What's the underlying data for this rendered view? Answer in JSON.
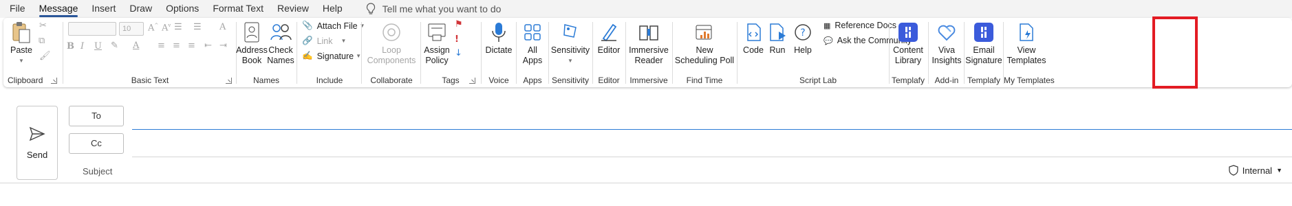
{
  "menu": {
    "tabs": [
      "File",
      "Message",
      "Insert",
      "Draw",
      "Options",
      "Format Text",
      "Review",
      "Help"
    ],
    "active_tab": "Message",
    "tell_me": "Tell me what you want to do"
  },
  "ribbon": {
    "clipboard": {
      "paste": "Paste",
      "label": "Clipboard"
    },
    "basic_text": {
      "font_size": "10",
      "label": "Basic Text"
    },
    "names": {
      "address_book_1": "Address",
      "address_book_2": "Book",
      "check_names_1": "Check",
      "check_names_2": "Names",
      "label": "Names"
    },
    "include": {
      "attach_file": "Attach File",
      "link": "Link",
      "signature": "Signature",
      "label": "Include"
    },
    "collaborate": {
      "loop_1": "Loop",
      "loop_2": "Components",
      "label": "Collaborate"
    },
    "tags": {
      "assign_1": "Assign",
      "assign_2": "Policy",
      "label": "Tags"
    },
    "voice": {
      "dictate": "Dictate",
      "label": "Voice"
    },
    "apps": {
      "all_1": "All",
      "all_2": "Apps",
      "label": "Apps"
    },
    "sensitivity": {
      "button": "Sensitivity",
      "label": "Sensitivity"
    },
    "editor": {
      "button": "Editor",
      "label": "Editor"
    },
    "immersive": {
      "btn_1": "Immersive",
      "btn_2": "Reader",
      "label": "Immersive"
    },
    "find_time": {
      "btn_1": "New",
      "btn_2": "Scheduling Poll",
      "label": "Find Time"
    },
    "script_lab": {
      "code": "Code",
      "run": "Run",
      "help": "Help",
      "reference_docs": "Reference Docs",
      "ask_community": "Ask the Community",
      "label": "Script Lab"
    },
    "templafy": {
      "btn_1": "Content",
      "btn_2": "Library",
      "label": "Templafy"
    },
    "addin": {
      "btn_1": "Viva",
      "btn_2": "Insights",
      "label": "Add-in"
    },
    "templafy2": {
      "btn_1": "Email",
      "btn_2": "Signature",
      "label": "Templafy"
    },
    "my_templates": {
      "btn_1": "View",
      "btn_2": "Templates",
      "label": "My Templates"
    }
  },
  "compose": {
    "send": "Send",
    "to": "To",
    "cc": "Cc",
    "subject": "Subject",
    "sensitivity": "Internal"
  },
  "colors": {
    "accent": "#2b579a",
    "templafy": "#3b5bdb",
    "highlight": "#e31b23",
    "active_line": "#2b7bd6"
  }
}
